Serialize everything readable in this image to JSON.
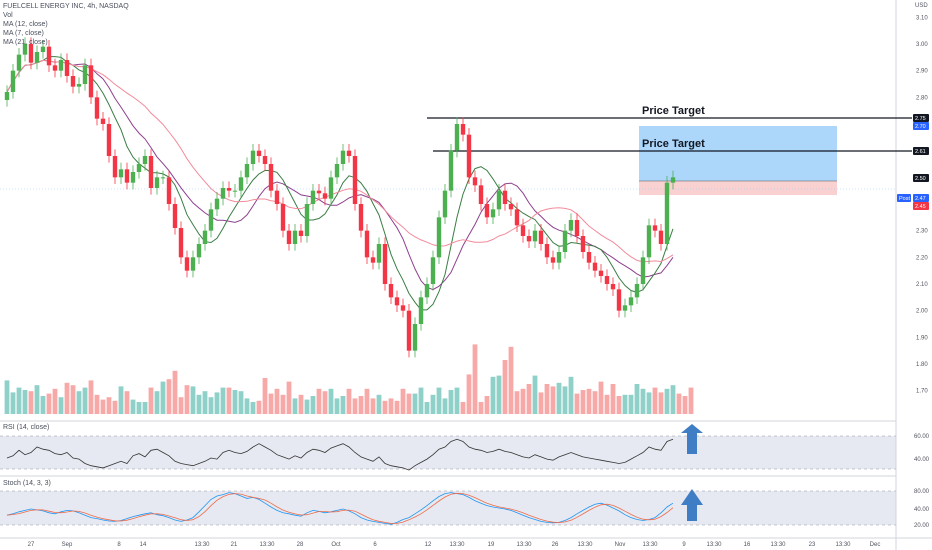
{
  "header": {
    "title": "FUELCELL ENERGY INC, 4h, NASDAQ",
    "vol_label": "Vol",
    "ma_labels": [
      "MA (12, close)",
      "MA (7, close)",
      "MA (21, close)"
    ]
  },
  "price_axis": {
    "currency": "USD",
    "ticks": [
      "3.10",
      "3.00",
      "2.90",
      "2.80",
      "2.70",
      "2.60",
      "2.50",
      "2.40",
      "2.30",
      "2.20",
      "2.10",
      "2.00",
      "1.90",
      "1.80",
      "1.70"
    ],
    "level_tags": [
      "2.75",
      "2.70",
      "2.61",
      "2.50",
      "2.47",
      "2.45"
    ],
    "post_label": "Post"
  },
  "time_axis": {
    "labels": [
      "27",
      "Sep",
      "8",
      "14",
      "13:30",
      "21",
      "13:30",
      "28",
      "Oct",
      "6",
      "12",
      "13:30",
      "19",
      "13:30",
      "26",
      "13:30",
      "Nov",
      "13:30",
      "9",
      "13:30",
      "16",
      "13:30",
      "23",
      "13:30",
      "Dec"
    ]
  },
  "annotations": {
    "upper_target": "Price Target",
    "lower_target": "Price Target",
    "rsi_arrow": "up-arrow-icon",
    "stoch_arrow": "up-arrow-icon"
  },
  "rsi_pane": {
    "label": "RSI (14, close)",
    "ticks": [
      "60.00",
      "40.00"
    ]
  },
  "stoch_pane": {
    "label": "Stoch (14, 3, 3)",
    "ticks": [
      "80.00",
      "40.00",
      "20.00"
    ]
  },
  "colors": {
    "up": "#26a69a",
    "down": "#ef5350",
    "up_candle": "#4caf50",
    "down_candle": "#f23645",
    "ma12": "#8e3f8e",
    "ma7": "#3a7d44",
    "ma21": "#f28b9b",
    "rsi_line": "#333333",
    "stoch_k": "#2196f3",
    "stoch_d": "#ef6c4a",
    "target_box": "#90caf9",
    "stop_box": "#f8c9c9",
    "arrow": "#3f7ec4"
  },
  "chart_data": {
    "type": "candlestick",
    "title": "FUELCELL ENERGY INC, 4h, NASDAQ",
    "ylim": [
      1.65,
      3.12
    ],
    "grid": false,
    "closes": [
      2.82,
      2.9,
      2.96,
      3.0,
      2.93,
      2.97,
      2.99,
      2.92,
      2.9,
      2.94,
      2.88,
      2.84,
      2.85,
      2.92,
      2.8,
      2.72,
      2.7,
      2.58,
      2.5,
      2.53,
      2.48,
      2.52,
      2.55,
      2.58,
      2.46,
      2.5,
      2.5,
      2.4,
      2.31,
      2.2,
      2.15,
      2.2,
      2.25,
      2.3,
      2.38,
      2.42,
      2.46,
      2.45,
      2.45,
      2.5,
      2.55,
      2.6,
      2.58,
      2.55,
      2.45,
      2.4,
      2.3,
      2.25,
      2.3,
      2.28,
      2.4,
      2.45,
      2.44,
      2.42,
      2.5,
      2.55,
      2.6,
      2.58,
      2.4,
      2.3,
      2.2,
      2.18,
      2.25,
      2.1,
      2.05,
      2.02,
      2.0,
      1.85,
      1.95,
      2.05,
      2.1,
      2.2,
      2.35,
      2.45,
      2.6,
      2.7,
      2.66,
      2.5,
      2.47,
      2.4,
      2.35,
      2.38,
      2.45,
      2.4,
      2.38,
      2.32,
      2.28,
      2.26,
      2.3,
      2.25,
      2.2,
      2.18,
      2.22,
      2.3,
      2.34,
      2.28,
      2.22,
      2.18,
      2.15,
      2.13,
      2.1,
      2.08,
      2.0,
      2.02,
      2.05,
      2.1,
      2.2,
      2.32,
      2.3,
      2.25,
      2.48,
      2.5
    ],
    "volume": [
      28,
      18,
      22,
      20,
      19,
      24,
      15,
      17,
      21,
      14,
      26,
      24,
      19,
      22,
      28,
      16,
      12,
      14,
      11,
      23,
      19,
      12,
      10,
      10,
      22,
      19,
      27,
      29,
      36,
      14,
      24,
      23,
      16,
      19,
      14,
      18,
      22,
      22,
      20,
      19,
      13,
      10,
      11,
      30,
      17,
      21,
      16,
      27,
      13,
      16,
      12,
      15,
      21,
      19,
      21,
      13,
      15,
      21,
      13,
      15,
      21,
      13,
      16,
      11,
      13,
      11,
      21,
      17,
      17,
      22,
      10,
      16,
      22,
      13,
      20,
      22,
      10,
      33,
      58,
      10,
      15,
      31,
      32,
      45,
      56,
      19,
      21,
      25,
      32,
      18,
      25,
      23,
      26,
      23,
      31,
      17,
      20,
      21,
      19,
      27,
      16,
      25,
      15,
      16,
      16,
      25,
      21,
      18,
      22,
      18,
      21,
      24,
      17,
      15,
      22
    ],
    "rsi": [
      45,
      47,
      52,
      48,
      50,
      55,
      53,
      52,
      49,
      48,
      50,
      45,
      44,
      40,
      38,
      37,
      36,
      38,
      40,
      42,
      40,
      47,
      49,
      46,
      52,
      53,
      50,
      47,
      42,
      40,
      39,
      38,
      40,
      42,
      45,
      44,
      50,
      52,
      50,
      49,
      51,
      55,
      58,
      55,
      52,
      48,
      46,
      44,
      47,
      45,
      50,
      53,
      52,
      50,
      54,
      56,
      58,
      55,
      50,
      46,
      44,
      42,
      46,
      40,
      38,
      37,
      36,
      34,
      38,
      41,
      44,
      48,
      53,
      55,
      60,
      62,
      60,
      55,
      53,
      52,
      50,
      51,
      53,
      51,
      50,
      48,
      46,
      45,
      48,
      46,
      44,
      43,
      46,
      48,
      50,
      48,
      46,
      45,
      44,
      43,
      42,
      41,
      40,
      41,
      44,
      47,
      50,
      55,
      53,
      52,
      60,
      62
    ],
    "stoch_k": [
      35,
      38,
      42,
      45,
      48,
      46,
      44,
      40,
      38,
      42,
      45,
      44,
      40,
      35,
      30,
      28,
      25,
      23,
      22,
      24,
      28,
      32,
      35,
      38,
      40,
      36,
      34,
      30,
      25,
      22,
      25,
      30,
      42,
      55,
      68,
      75,
      78,
      82,
      80,
      75,
      70,
      72,
      68,
      60,
      52,
      45,
      40,
      38,
      35,
      33,
      40,
      45,
      43,
      40,
      42,
      45,
      48,
      44,
      38,
      30,
      25,
      22,
      20,
      18,
      16,
      20,
      26,
      30,
      38,
      46,
      55,
      65,
      74,
      80,
      82,
      80,
      78,
      72,
      65,
      60,
      55,
      52,
      50,
      48,
      45,
      40,
      35,
      30,
      26,
      22,
      20,
      19,
      20,
      24,
      30,
      38,
      45,
      52,
      58,
      60,
      56,
      50,
      44,
      36,
      30,
      26,
      24,
      26,
      30,
      40,
      52,
      60
    ]
  }
}
